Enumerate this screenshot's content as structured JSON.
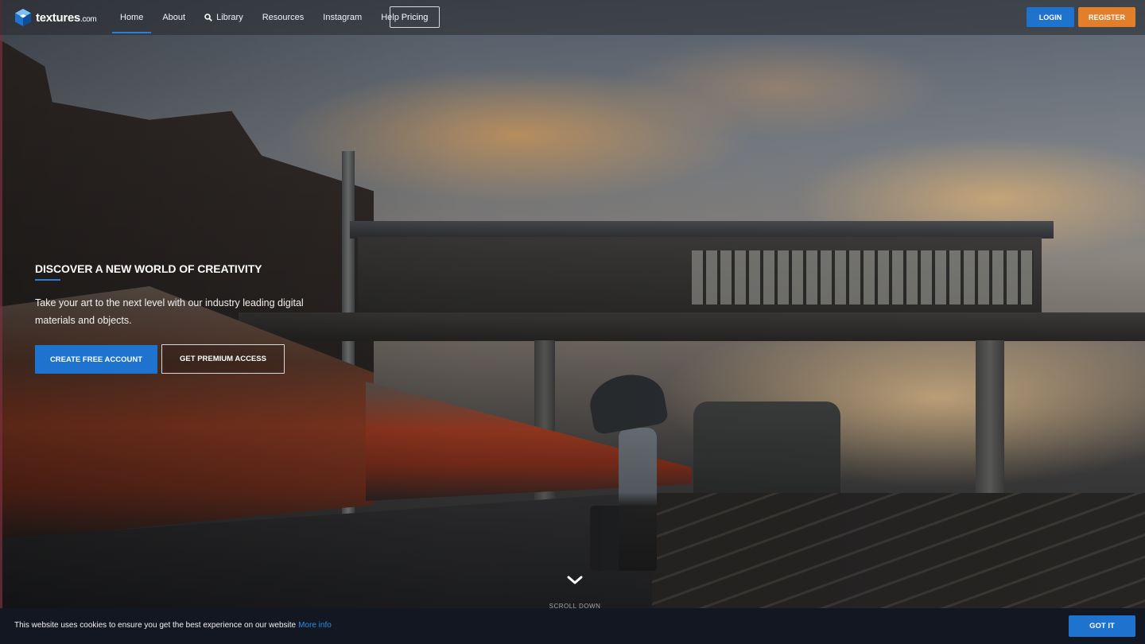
{
  "header": {
    "logo_text": "textures",
    "logo_suffix": ".com",
    "nav": [
      {
        "label": "Home",
        "active": true
      },
      {
        "label": "About"
      },
      {
        "label": "Library",
        "icon": "search-icon"
      },
      {
        "label": "Resources"
      },
      {
        "label": "Instagram"
      },
      {
        "label": "Help"
      }
    ],
    "pricing_label": "Pricing",
    "login_label": "LOGIN",
    "register_label": "REGISTER"
  },
  "hero": {
    "title": "DISCOVER A NEW WORLD OF CREATIVITY",
    "subtitle": "Take your art to the next level with our industry leading digital materials and objects.",
    "primary_cta": "CREATE FREE ACCOUNT",
    "secondary_cta": "GET PREMIUM ACCESS",
    "scroll_label": "SCROLL DOWN"
  },
  "cookie": {
    "text": "This website uses cookies to ensure you get the best experience on our website",
    "link_text": "More info",
    "button_label": "GOT IT"
  },
  "colors": {
    "accent_blue": "#1e73cf",
    "register_orange": "#e17f2b",
    "cookie_bg": "#131722",
    "link_blue": "#2a8de4"
  }
}
